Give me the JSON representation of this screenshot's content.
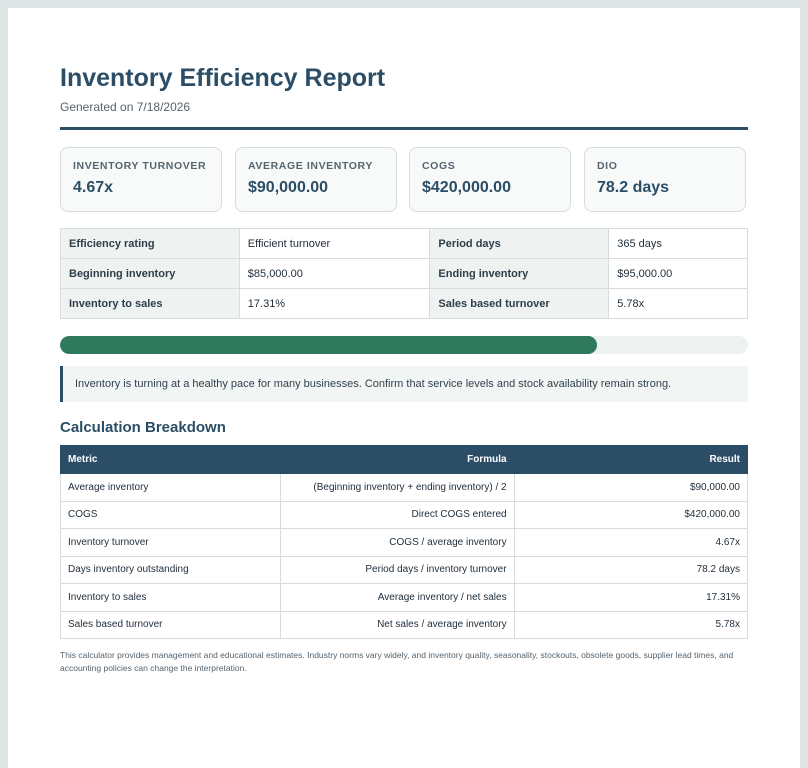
{
  "report": {
    "title": "Inventory Efficiency Report",
    "generated": "Generated on 7/18/2026"
  },
  "cards": [
    {
      "label": "INVENTORY TURNOVER",
      "value": "4.67x"
    },
    {
      "label": "AVERAGE INVENTORY",
      "value": "$90,000.00"
    },
    {
      "label": "COGS",
      "value": "$420,000.00"
    },
    {
      "label": "DIO",
      "value": "78.2 days"
    }
  ],
  "summary": {
    "rows": [
      [
        {
          "k": "Efficiency rating",
          "v": "Efficient turnover"
        },
        {
          "k": "Period days",
          "v": "365 days"
        }
      ],
      [
        {
          "k": "Beginning inventory",
          "v": "$85,000.00"
        },
        {
          "k": "Ending inventory",
          "v": "$95,000.00"
        }
      ],
      [
        {
          "k": "Inventory to sales",
          "v": "17.31%"
        },
        {
          "k": "Sales based turnover",
          "v": "5.78x"
        }
      ]
    ]
  },
  "progress": {
    "fraction": 0.78
  },
  "note": "Inventory is turning at a healthy pace for many businesses. Confirm that service levels and stock availability remain strong.",
  "breakdown": {
    "title": "Calculation Breakdown",
    "headers": [
      "Metric",
      "Formula",
      "Result"
    ],
    "rows": [
      [
        "Average inventory",
        "(Beginning inventory + ending inventory) / 2",
        "$90,000.00"
      ],
      [
        "COGS",
        "Direct COGS entered",
        "$420,000.00"
      ],
      [
        "Inventory turnover",
        "COGS / average inventory",
        "4.67x"
      ],
      [
        "Days inventory outstanding",
        "Period days / inventory turnover",
        "78.2 days"
      ],
      [
        "Inventory to sales",
        "Average inventory / net sales",
        "17.31%"
      ],
      [
        "Sales based turnover",
        "Net sales / average inventory",
        "5.78x"
      ]
    ]
  },
  "disclaimer": "This calculator provides management and educational estimates. Industry norms vary widely, and inventory quality, seasonality, stockouts, obsolete goods, supplier lead times, and accounting policies can change the interpretation.",
  "colors": {
    "accent": "#2b4e66",
    "progress_fill": "#2f7a5c"
  }
}
